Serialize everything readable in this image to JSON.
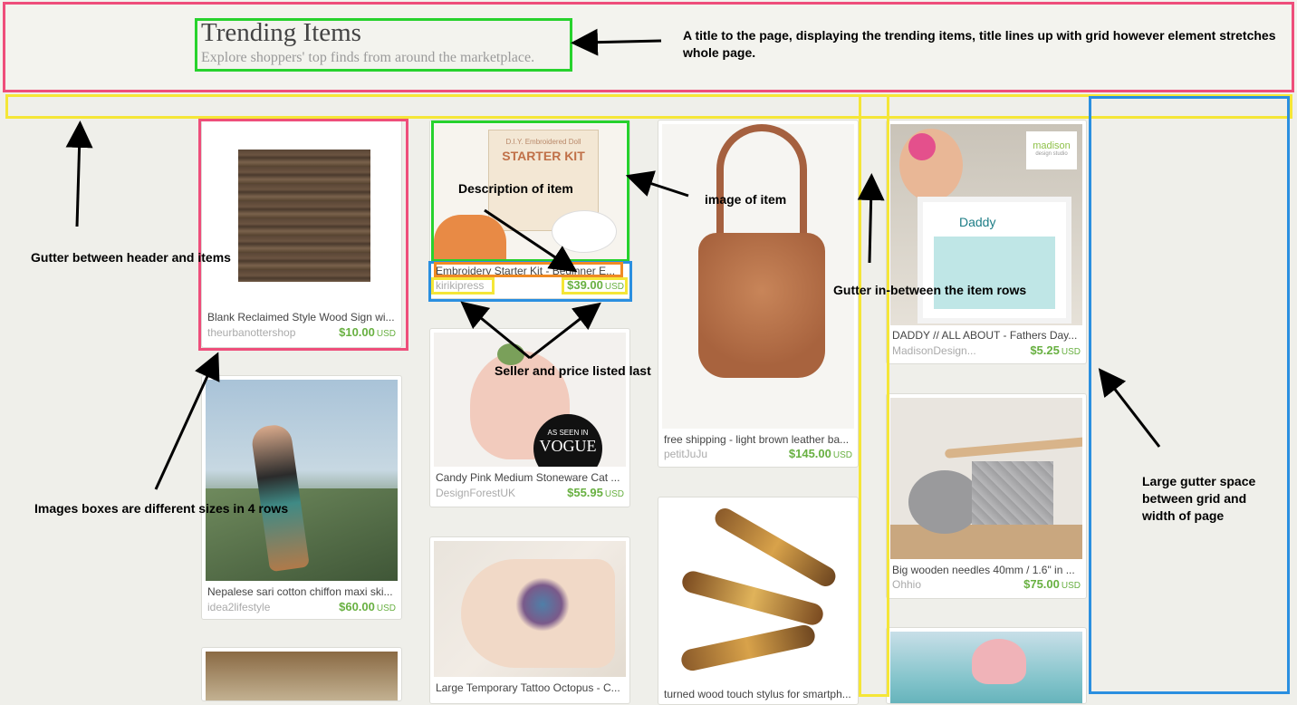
{
  "header": {
    "title": "Trending Items",
    "subtitle": "Explore shoppers' top finds from around the marketplace."
  },
  "items": [
    {
      "description": "Blank Reclaimed Style Wood Sign wi...",
      "seller": "theurbanottershop",
      "price": "$10.00",
      "currency": "USD",
      "image": "wood-sign-image"
    },
    {
      "description": "Nepalese sari cotton chiffon maxi ski...",
      "seller": "idea2lifestyle",
      "price": "$60.00",
      "currency": "USD",
      "image": "dancer-image"
    },
    {
      "description": "Embroidery Starter Kit - Beginner E...",
      "seller": "kirikipress",
      "price": "$39.00",
      "currency": "USD",
      "image": "starter-kit-image",
      "kit_box_text": "D.I.Y. Embroidered Doll",
      "kit_title": "STARTER KIT"
    },
    {
      "description": "Candy Pink Medium Stoneware Cat ...",
      "seller": "DesignForestUK",
      "price": "$55.95",
      "currency": "USD",
      "image": "cat-planter-image",
      "badge_top": "AS SEEN IN",
      "badge_brand": "VOGUE"
    },
    {
      "description": "Large Temporary Tattoo Octopus - C...",
      "seller": "",
      "price": "",
      "currency": "",
      "image": "tattoo-image"
    },
    {
      "description": "free shipping - light brown leather ba...",
      "seller": "petitJuJu",
      "price": "$145.00",
      "currency": "USD",
      "image": "leather-bag-image"
    },
    {
      "description": "turned wood touch stylus for smartph...",
      "seller": "",
      "price": "",
      "currency": "",
      "image": "stylus-image"
    },
    {
      "description": "DADDY // ALL ABOUT - Fathers Day...",
      "seller": "MadisonDesign...",
      "price": "$5.25",
      "currency": "USD",
      "image": "daddy-frame-image",
      "logo_line1": "madison",
      "logo_line2": "design studio",
      "frame_word": "Daddy"
    },
    {
      "description": "Big wooden needles 40mm / 1.6\" in ...",
      "seller": "Ohhio",
      "price": "$75.00",
      "currency": "USD",
      "image": "knitting-image"
    }
  ],
  "annotations": {
    "title_note": "A title to the page, displaying the trending items, title lines up with grid however element stretches whole page.",
    "gutter_header": "Gutter between header and items",
    "description_note": "Description of item",
    "image_note": "image of item",
    "gutter_rows": "Gutter in-between the item rows",
    "seller_price": "Seller and price listed last",
    "image_sizes": "Images boxes are different sizes in 4 rows",
    "large_gutter": "Large gutter space between grid and width of page"
  },
  "colors": {
    "background": "#efefea",
    "price": "#68b041",
    "pink_box": "#ee4e7b",
    "green_box": "#27d22d",
    "yellow_box": "#f5e637",
    "blue_box": "#2a8fe0",
    "orange_box": "#f08a24"
  }
}
